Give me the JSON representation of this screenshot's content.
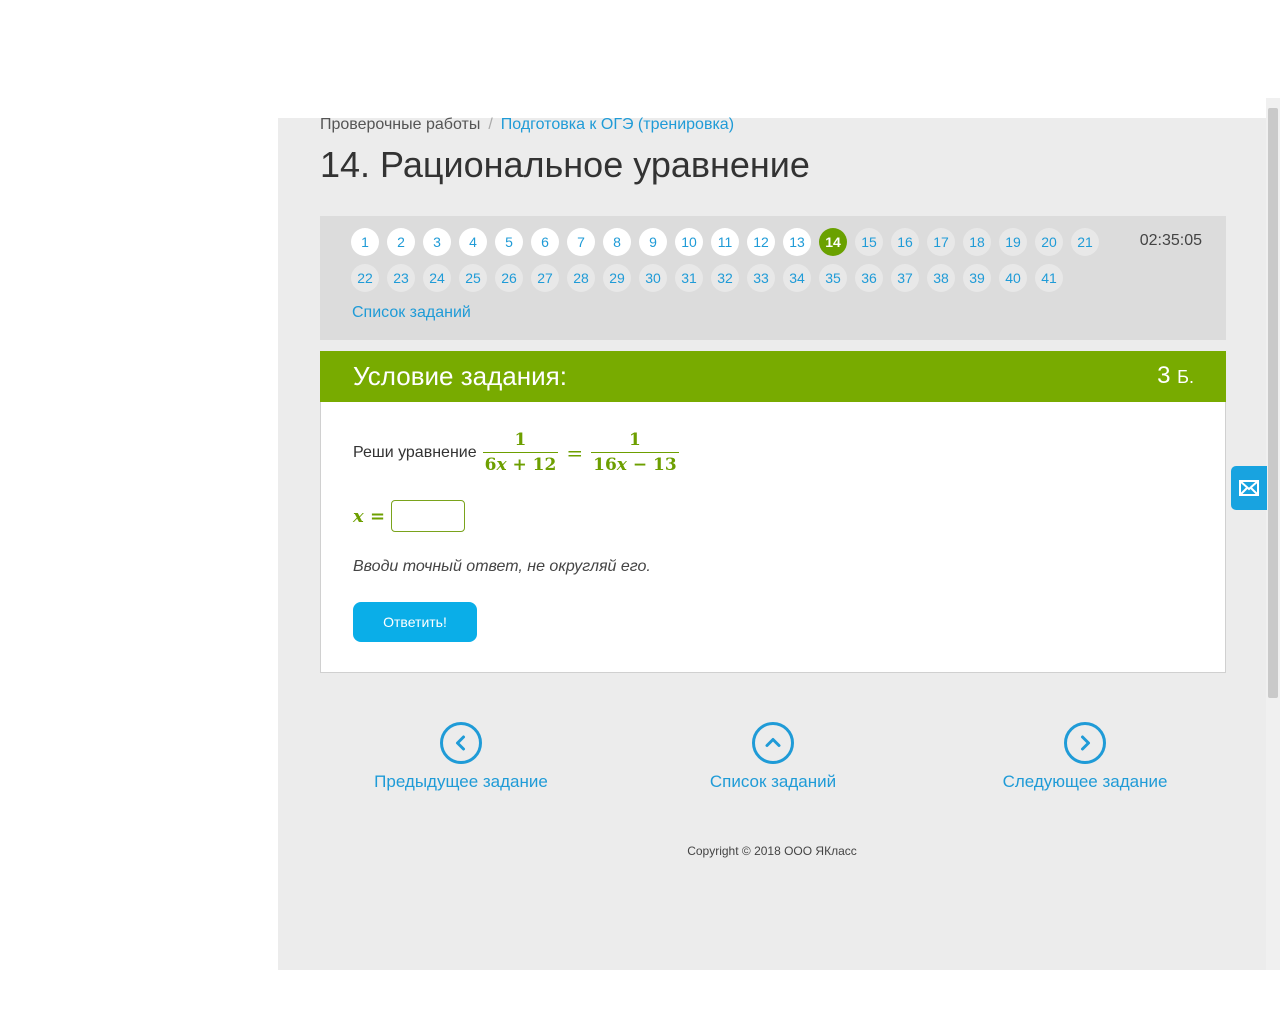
{
  "breadcrumb": {
    "root": "Проверочные работы",
    "separator": "/",
    "current": "Подготовка к ОГЭ (тренировка)"
  },
  "page_title": "14. Рациональное уравнение",
  "task_nav": {
    "row1": [
      "1",
      "2",
      "3",
      "4",
      "5",
      "6",
      "7",
      "8",
      "9",
      "10",
      "11",
      "12",
      "13",
      "14",
      "15",
      "16",
      "17",
      "18",
      "19",
      "20",
      "21"
    ],
    "row2": [
      "22",
      "23",
      "24",
      "25",
      "26",
      "27",
      "28",
      "29",
      "30",
      "31",
      "32",
      "33",
      "34",
      "35",
      "36",
      "37",
      "38",
      "39",
      "40",
      "41"
    ],
    "current": "14",
    "timer": "02:35:05",
    "list_link": "Список заданий"
  },
  "condition": {
    "title": "Условие задания:",
    "points_value": "3",
    "points_unit": "Б.",
    "prompt": "Реши уравнение",
    "lhs_numerator": "1",
    "lhs_den_a": "6",
    "lhs_den_var": "x",
    "lhs_den_b": " + 12",
    "rhs_numerator": "1",
    "rhs_den_a": "16",
    "rhs_den_var": "x",
    "rhs_den_b": " − 13",
    "equals": "=",
    "answer_var": "x",
    "answer_equals": "=",
    "answer_value": "",
    "hint": "Вводи точный ответ, не округляй его.",
    "submit_label": "Ответить!"
  },
  "bottom_nav": {
    "prev_label": "Предыдущее задание",
    "list_label": "Список заданий",
    "next_label": "Следующее задание"
  },
  "footer": {
    "copyright": "Copyright © 2018 ООО ЯКласс"
  },
  "colors": {
    "accent_green": "#78ab00",
    "link_blue": "#1f9bd7",
    "button_blue": "#0aaee8"
  },
  "icons": {
    "prev": "chevron-left-circle-icon",
    "list": "chevron-up-circle-icon",
    "next": "chevron-right-circle-icon",
    "feedback": "envelope-icon"
  }
}
